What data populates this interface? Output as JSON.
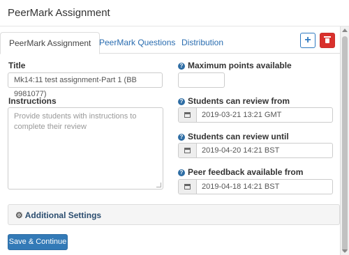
{
  "window": {
    "title": "PeerMark Assignment"
  },
  "tabs": [
    {
      "label": "PeerMark Assignment"
    },
    {
      "label": "PeerMark Questions"
    },
    {
      "label": "Distribution"
    }
  ],
  "actions": {
    "add_icon": "plus-icon",
    "delete_icon": "trash-icon"
  },
  "form": {
    "title_label": "Title",
    "title_value": "Mk14:11 test assignment-Part 1 (BB 9981077)",
    "instructions_label": "Instructions",
    "instructions_placeholder": "Provide students with instructions to complete their review",
    "max_points_label": "Maximum points available",
    "max_points_value": "",
    "review_from_label": "Students can review from",
    "review_from_value": "2019-03-21 13:21 GMT",
    "review_until_label": "Students can review until",
    "review_until_value": "2019-04-20 14:21 BST",
    "feedback_label": "Peer feedback available from",
    "feedback_value": "2019-04-18 14:21 BST"
  },
  "additional_settings": {
    "label": "Additional Settings"
  },
  "save_button": {
    "label": "Save & Continue"
  },
  "colors": {
    "primary": "#337ab7",
    "danger": "#d9302c",
    "link": "#2a6db0"
  }
}
